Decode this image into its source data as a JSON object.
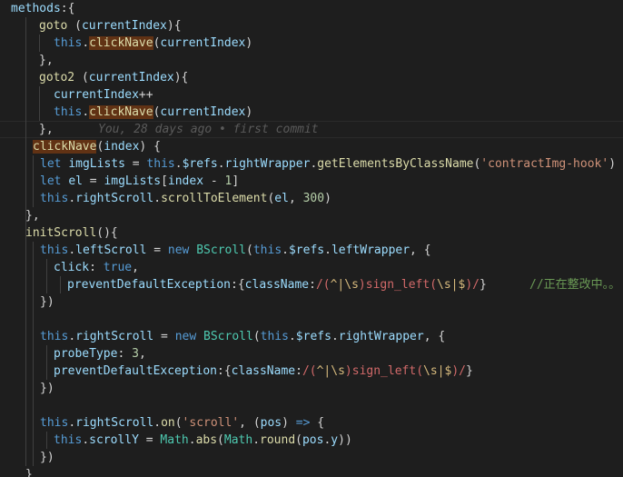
{
  "code": {
    "l1_methods": "methods",
    "l2_goto": "goto",
    "l2_param": "currentIndex",
    "l3_this": "this",
    "l3_fn": "clickNave",
    "l3_arg": "currentIndex",
    "l5_goto2": "goto2",
    "l5_param": "currentIndex",
    "l6_var": "currentIndex",
    "l7_this": "this",
    "l7_fn": "clickNave",
    "l7_arg": "currentIndex",
    "l9_fn": "clickNave",
    "l9_param": "index",
    "l10_let": "let",
    "l10_var": "imgLists",
    "l10_this": "this",
    "l10_refs": "$refs",
    "l10_ref": "rightWrapper",
    "l10_method": "getElementsByClassName",
    "l10_str": "'contractImg-hook'",
    "l11_let": "let",
    "l11_var": "el",
    "l11_arr": "imgLists",
    "l11_idx": "index",
    "l11_num": "1",
    "l12_this": "this",
    "l12_prop": "rightScroll",
    "l12_method": "scrollToElement",
    "l12_arg": "el",
    "l12_num": "300",
    "l14_fn": "initScroll",
    "l15_this": "this",
    "l15_prop": "leftScroll",
    "l15_new": "new",
    "l15_cls": "BScroll",
    "l15_this2": "this",
    "l15_refs": "$refs",
    "l15_ref": "leftWrapper",
    "l16_key": "click",
    "l16_val": "true",
    "l17_key": "preventDefaultException",
    "l17_key2": "className",
    "l17_re_pre": "/(",
    "l17_re_b1": "^|\\s",
    "l17_re_mid": ")sign_left(",
    "l17_re_b2": "\\s|$",
    "l17_re_end": ")/",
    "l17_comment": "//正在整改中。。",
    "l20_this": "this",
    "l20_prop": "rightScroll",
    "l20_new": "new",
    "l20_cls": "BScroll",
    "l20_this2": "this",
    "l20_refs": "$refs",
    "l20_ref": "rightWrapper",
    "l21_key": "probeType",
    "l21_val": "3",
    "l22_key": "preventDefaultException",
    "l22_key2": "className",
    "l22_re_pre": "/(",
    "l22_re_b1": "^|\\s",
    "l22_re_mid": ")sign_left(",
    "l22_re_b2": "\\s|$",
    "l22_re_end": ")/",
    "l25_this": "this",
    "l25_prop": "rightScroll",
    "l25_method": "on",
    "l25_str": "'scroll'",
    "l25_param": "pos",
    "l26_this": "this",
    "l26_prop": "scrollY",
    "l26_math": "Math",
    "l26_abs": "abs",
    "l26_math2": "Math",
    "l26_round": "round",
    "l26_obj": "pos",
    "l26_y": "y"
  },
  "blame": {
    "text": "You, 28 days ago • first commit"
  },
  "colors": {
    "background": "#1e1e1e",
    "text": "#d4d4d4",
    "function": "#dcdcaa",
    "keyword": "#569cd6",
    "variable": "#9cdcfe",
    "class": "#4ec9b0",
    "number": "#b5cea8",
    "string": "#ce9178",
    "regex": "#d16969",
    "comment": "#6a9955",
    "highlight": "#613214"
  }
}
